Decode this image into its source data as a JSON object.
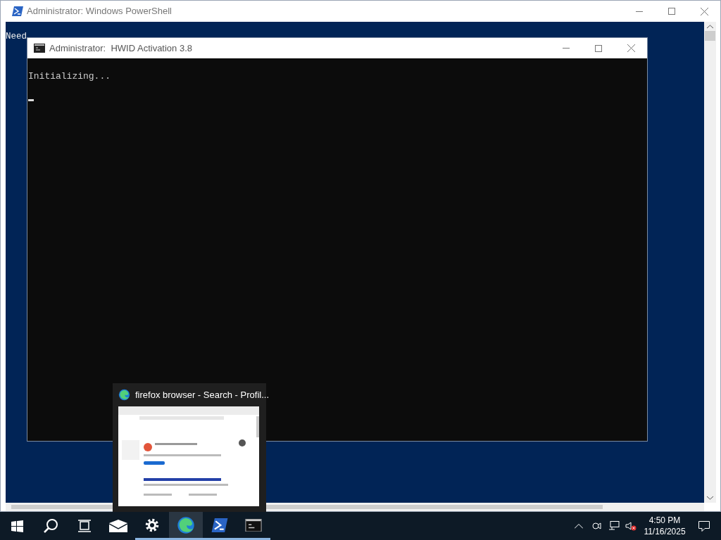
{
  "powershell_window": {
    "title": "Administrator: Windows PowerShell",
    "line": {
      "text": "Need"
    }
  },
  "cmd_window": {
    "title": "Administrator:  HWID Activation 3.8",
    "output": [
      "Initializing..."
    ]
  },
  "thumbnail": {
    "title": "firefox browser - Search - Profil..."
  },
  "taskbar": {
    "items": [
      {
        "kind": "start",
        "running": false,
        "active": false
      },
      {
        "kind": "search",
        "running": false,
        "active": false
      },
      {
        "kind": "taskview",
        "running": false,
        "active": false
      },
      {
        "kind": "mail",
        "running": false,
        "active": false
      },
      {
        "kind": "settings",
        "running": true,
        "active": false
      },
      {
        "kind": "edge",
        "running": true,
        "active": true
      },
      {
        "kind": "powershell",
        "running": true,
        "active": false
      },
      {
        "kind": "cmd",
        "running": true,
        "active": false
      }
    ],
    "clock": {
      "time": "4:50 PM",
      "date": "11/16/2025"
    }
  }
}
